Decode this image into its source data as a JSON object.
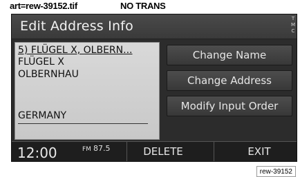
{
  "caption": {
    "left": "art=rew-39152.tif",
    "right": "NO TRANS"
  },
  "header": {
    "title": "Edit Address Info",
    "logo_text": "T M C"
  },
  "entry": {
    "title": "5) FLÜGEL X, OLBERN...",
    "line1": "FLÜGEL X",
    "line2": "OLBERNHAU",
    "line3": "GERMANY"
  },
  "buttons": {
    "change_name": "Change Name",
    "change_address": "Change Address",
    "modify_order": "Modify Input Order"
  },
  "status": {
    "clock": "12:00",
    "band": "FM",
    "frequency": "87.5",
    "delete_label": "DELETE",
    "exit_label": "EXIT"
  },
  "figure_code": "rew-39152"
}
